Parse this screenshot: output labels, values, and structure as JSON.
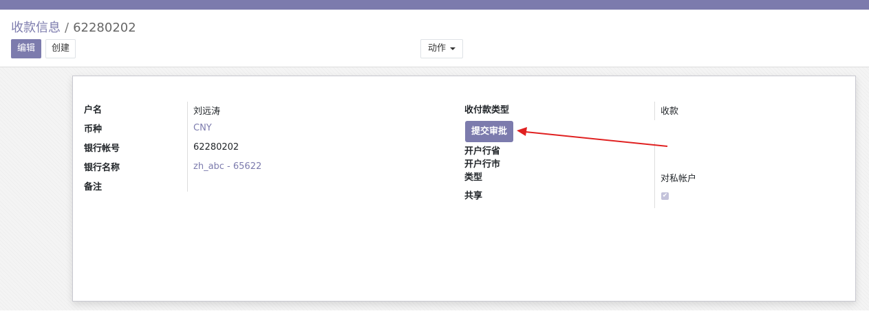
{
  "breadcrumb": {
    "parent": "收款信息",
    "separator": "/",
    "current": "62280202"
  },
  "toolbar": {
    "edit_label": "编辑",
    "create_label": "创建",
    "action_label": "动作"
  },
  "form": {
    "left_fields": [
      {
        "label": "户名",
        "value": "刘远涛"
      },
      {
        "label": "币种",
        "value": "CNY"
      },
      {
        "label": "银行帐号",
        "value": "62280202"
      },
      {
        "label": "银行名称",
        "value": "zh_abc - 65622"
      },
      {
        "label": "备注",
        "value": ""
      }
    ],
    "payment_type": {
      "label": "收付款类型",
      "value": "收款"
    },
    "submit_button": "提交审批",
    "province": {
      "label": "开户行省"
    },
    "city": {
      "label": "开户行市"
    },
    "account_type": {
      "label": "类型",
      "value": "对私帐户"
    },
    "shared": {
      "label": "共享",
      "checked": true
    }
  },
  "colors": {
    "brand": "#7c7bad",
    "annotation_arrow": "#e02020"
  }
}
